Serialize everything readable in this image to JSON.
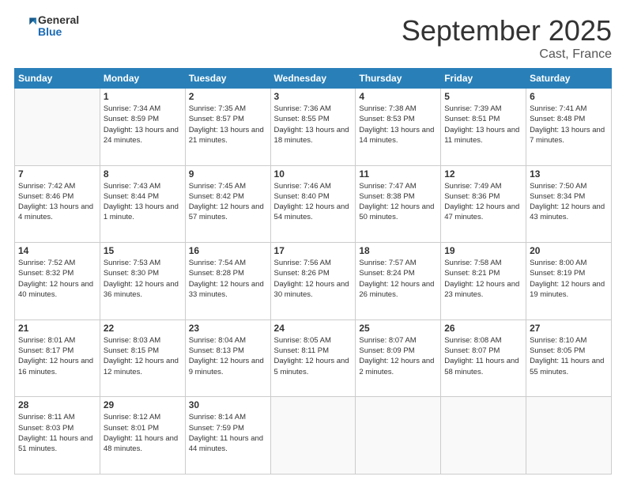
{
  "header": {
    "logo_line1": "General",
    "logo_line2": "Blue",
    "month": "September 2025",
    "location": "Cast, France"
  },
  "weekdays": [
    "Sunday",
    "Monday",
    "Tuesday",
    "Wednesday",
    "Thursday",
    "Friday",
    "Saturday"
  ],
  "weeks": [
    [
      {
        "num": "",
        "sunrise": "",
        "sunset": "",
        "daylight": ""
      },
      {
        "num": "1",
        "sunrise": "Sunrise: 7:34 AM",
        "sunset": "Sunset: 8:59 PM",
        "daylight": "Daylight: 13 hours and 24 minutes."
      },
      {
        "num": "2",
        "sunrise": "Sunrise: 7:35 AM",
        "sunset": "Sunset: 8:57 PM",
        "daylight": "Daylight: 13 hours and 21 minutes."
      },
      {
        "num": "3",
        "sunrise": "Sunrise: 7:36 AM",
        "sunset": "Sunset: 8:55 PM",
        "daylight": "Daylight: 13 hours and 18 minutes."
      },
      {
        "num": "4",
        "sunrise": "Sunrise: 7:38 AM",
        "sunset": "Sunset: 8:53 PM",
        "daylight": "Daylight: 13 hours and 14 minutes."
      },
      {
        "num": "5",
        "sunrise": "Sunrise: 7:39 AM",
        "sunset": "Sunset: 8:51 PM",
        "daylight": "Daylight: 13 hours and 11 minutes."
      },
      {
        "num": "6",
        "sunrise": "Sunrise: 7:41 AM",
        "sunset": "Sunset: 8:48 PM",
        "daylight": "Daylight: 13 hours and 7 minutes."
      }
    ],
    [
      {
        "num": "7",
        "sunrise": "Sunrise: 7:42 AM",
        "sunset": "Sunset: 8:46 PM",
        "daylight": "Daylight: 13 hours and 4 minutes."
      },
      {
        "num": "8",
        "sunrise": "Sunrise: 7:43 AM",
        "sunset": "Sunset: 8:44 PM",
        "daylight": "Daylight: 13 hours and 1 minute."
      },
      {
        "num": "9",
        "sunrise": "Sunrise: 7:45 AM",
        "sunset": "Sunset: 8:42 PM",
        "daylight": "Daylight: 12 hours and 57 minutes."
      },
      {
        "num": "10",
        "sunrise": "Sunrise: 7:46 AM",
        "sunset": "Sunset: 8:40 PM",
        "daylight": "Daylight: 12 hours and 54 minutes."
      },
      {
        "num": "11",
        "sunrise": "Sunrise: 7:47 AM",
        "sunset": "Sunset: 8:38 PM",
        "daylight": "Daylight: 12 hours and 50 minutes."
      },
      {
        "num": "12",
        "sunrise": "Sunrise: 7:49 AM",
        "sunset": "Sunset: 8:36 PM",
        "daylight": "Daylight: 12 hours and 47 minutes."
      },
      {
        "num": "13",
        "sunrise": "Sunrise: 7:50 AM",
        "sunset": "Sunset: 8:34 PM",
        "daylight": "Daylight: 12 hours and 43 minutes."
      }
    ],
    [
      {
        "num": "14",
        "sunrise": "Sunrise: 7:52 AM",
        "sunset": "Sunset: 8:32 PM",
        "daylight": "Daylight: 12 hours and 40 minutes."
      },
      {
        "num": "15",
        "sunrise": "Sunrise: 7:53 AM",
        "sunset": "Sunset: 8:30 PM",
        "daylight": "Daylight: 12 hours and 36 minutes."
      },
      {
        "num": "16",
        "sunrise": "Sunrise: 7:54 AM",
        "sunset": "Sunset: 8:28 PM",
        "daylight": "Daylight: 12 hours and 33 minutes."
      },
      {
        "num": "17",
        "sunrise": "Sunrise: 7:56 AM",
        "sunset": "Sunset: 8:26 PM",
        "daylight": "Daylight: 12 hours and 30 minutes."
      },
      {
        "num": "18",
        "sunrise": "Sunrise: 7:57 AM",
        "sunset": "Sunset: 8:24 PM",
        "daylight": "Daylight: 12 hours and 26 minutes."
      },
      {
        "num": "19",
        "sunrise": "Sunrise: 7:58 AM",
        "sunset": "Sunset: 8:21 PM",
        "daylight": "Daylight: 12 hours and 23 minutes."
      },
      {
        "num": "20",
        "sunrise": "Sunrise: 8:00 AM",
        "sunset": "Sunset: 8:19 PM",
        "daylight": "Daylight: 12 hours and 19 minutes."
      }
    ],
    [
      {
        "num": "21",
        "sunrise": "Sunrise: 8:01 AM",
        "sunset": "Sunset: 8:17 PM",
        "daylight": "Daylight: 12 hours and 16 minutes."
      },
      {
        "num": "22",
        "sunrise": "Sunrise: 8:03 AM",
        "sunset": "Sunset: 8:15 PM",
        "daylight": "Daylight: 12 hours and 12 minutes."
      },
      {
        "num": "23",
        "sunrise": "Sunrise: 8:04 AM",
        "sunset": "Sunset: 8:13 PM",
        "daylight": "Daylight: 12 hours and 9 minutes."
      },
      {
        "num": "24",
        "sunrise": "Sunrise: 8:05 AM",
        "sunset": "Sunset: 8:11 PM",
        "daylight": "Daylight: 12 hours and 5 minutes."
      },
      {
        "num": "25",
        "sunrise": "Sunrise: 8:07 AM",
        "sunset": "Sunset: 8:09 PM",
        "daylight": "Daylight: 12 hours and 2 minutes."
      },
      {
        "num": "26",
        "sunrise": "Sunrise: 8:08 AM",
        "sunset": "Sunset: 8:07 PM",
        "daylight": "Daylight: 11 hours and 58 minutes."
      },
      {
        "num": "27",
        "sunrise": "Sunrise: 8:10 AM",
        "sunset": "Sunset: 8:05 PM",
        "daylight": "Daylight: 11 hours and 55 minutes."
      }
    ],
    [
      {
        "num": "28",
        "sunrise": "Sunrise: 8:11 AM",
        "sunset": "Sunset: 8:03 PM",
        "daylight": "Daylight: 11 hours and 51 minutes."
      },
      {
        "num": "29",
        "sunrise": "Sunrise: 8:12 AM",
        "sunset": "Sunset: 8:01 PM",
        "daylight": "Daylight: 11 hours and 48 minutes."
      },
      {
        "num": "30",
        "sunrise": "Sunrise: 8:14 AM",
        "sunset": "Sunset: 7:59 PM",
        "daylight": "Daylight: 11 hours and 44 minutes."
      },
      {
        "num": "",
        "sunrise": "",
        "sunset": "",
        "daylight": ""
      },
      {
        "num": "",
        "sunrise": "",
        "sunset": "",
        "daylight": ""
      },
      {
        "num": "",
        "sunrise": "",
        "sunset": "",
        "daylight": ""
      },
      {
        "num": "",
        "sunrise": "",
        "sunset": "",
        "daylight": ""
      }
    ]
  ]
}
